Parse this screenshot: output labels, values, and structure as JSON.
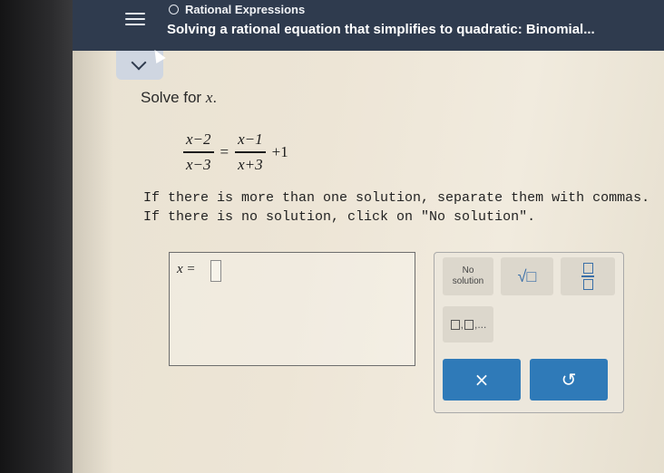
{
  "header": {
    "topic": "Rational Expressions",
    "lesson_title": "Solving a rational equation that simplifies to quadratic: Binomial..."
  },
  "problem": {
    "prompt_prefix": "Solve for ",
    "prompt_var": "x",
    "prompt_suffix": ".",
    "equation": {
      "left_num": "x−2",
      "left_den": "x−3",
      "equals": "=",
      "right_num": "x−1",
      "right_den": "x+3",
      "plus_term": "+1"
    },
    "instruction_line1": "If there is more than one solution, separate them with commas.",
    "instruction_line2": "If there is no solution, click on \"No solution\"."
  },
  "answer": {
    "label": "x =",
    "value": ""
  },
  "keypad": {
    "no_solution_line1": "No",
    "no_solution_line2": "solution",
    "sqrt_label": "√□",
    "list_suffix": ",..."
  },
  "actions": {
    "clear_label": "×",
    "undo_label": "↺"
  }
}
